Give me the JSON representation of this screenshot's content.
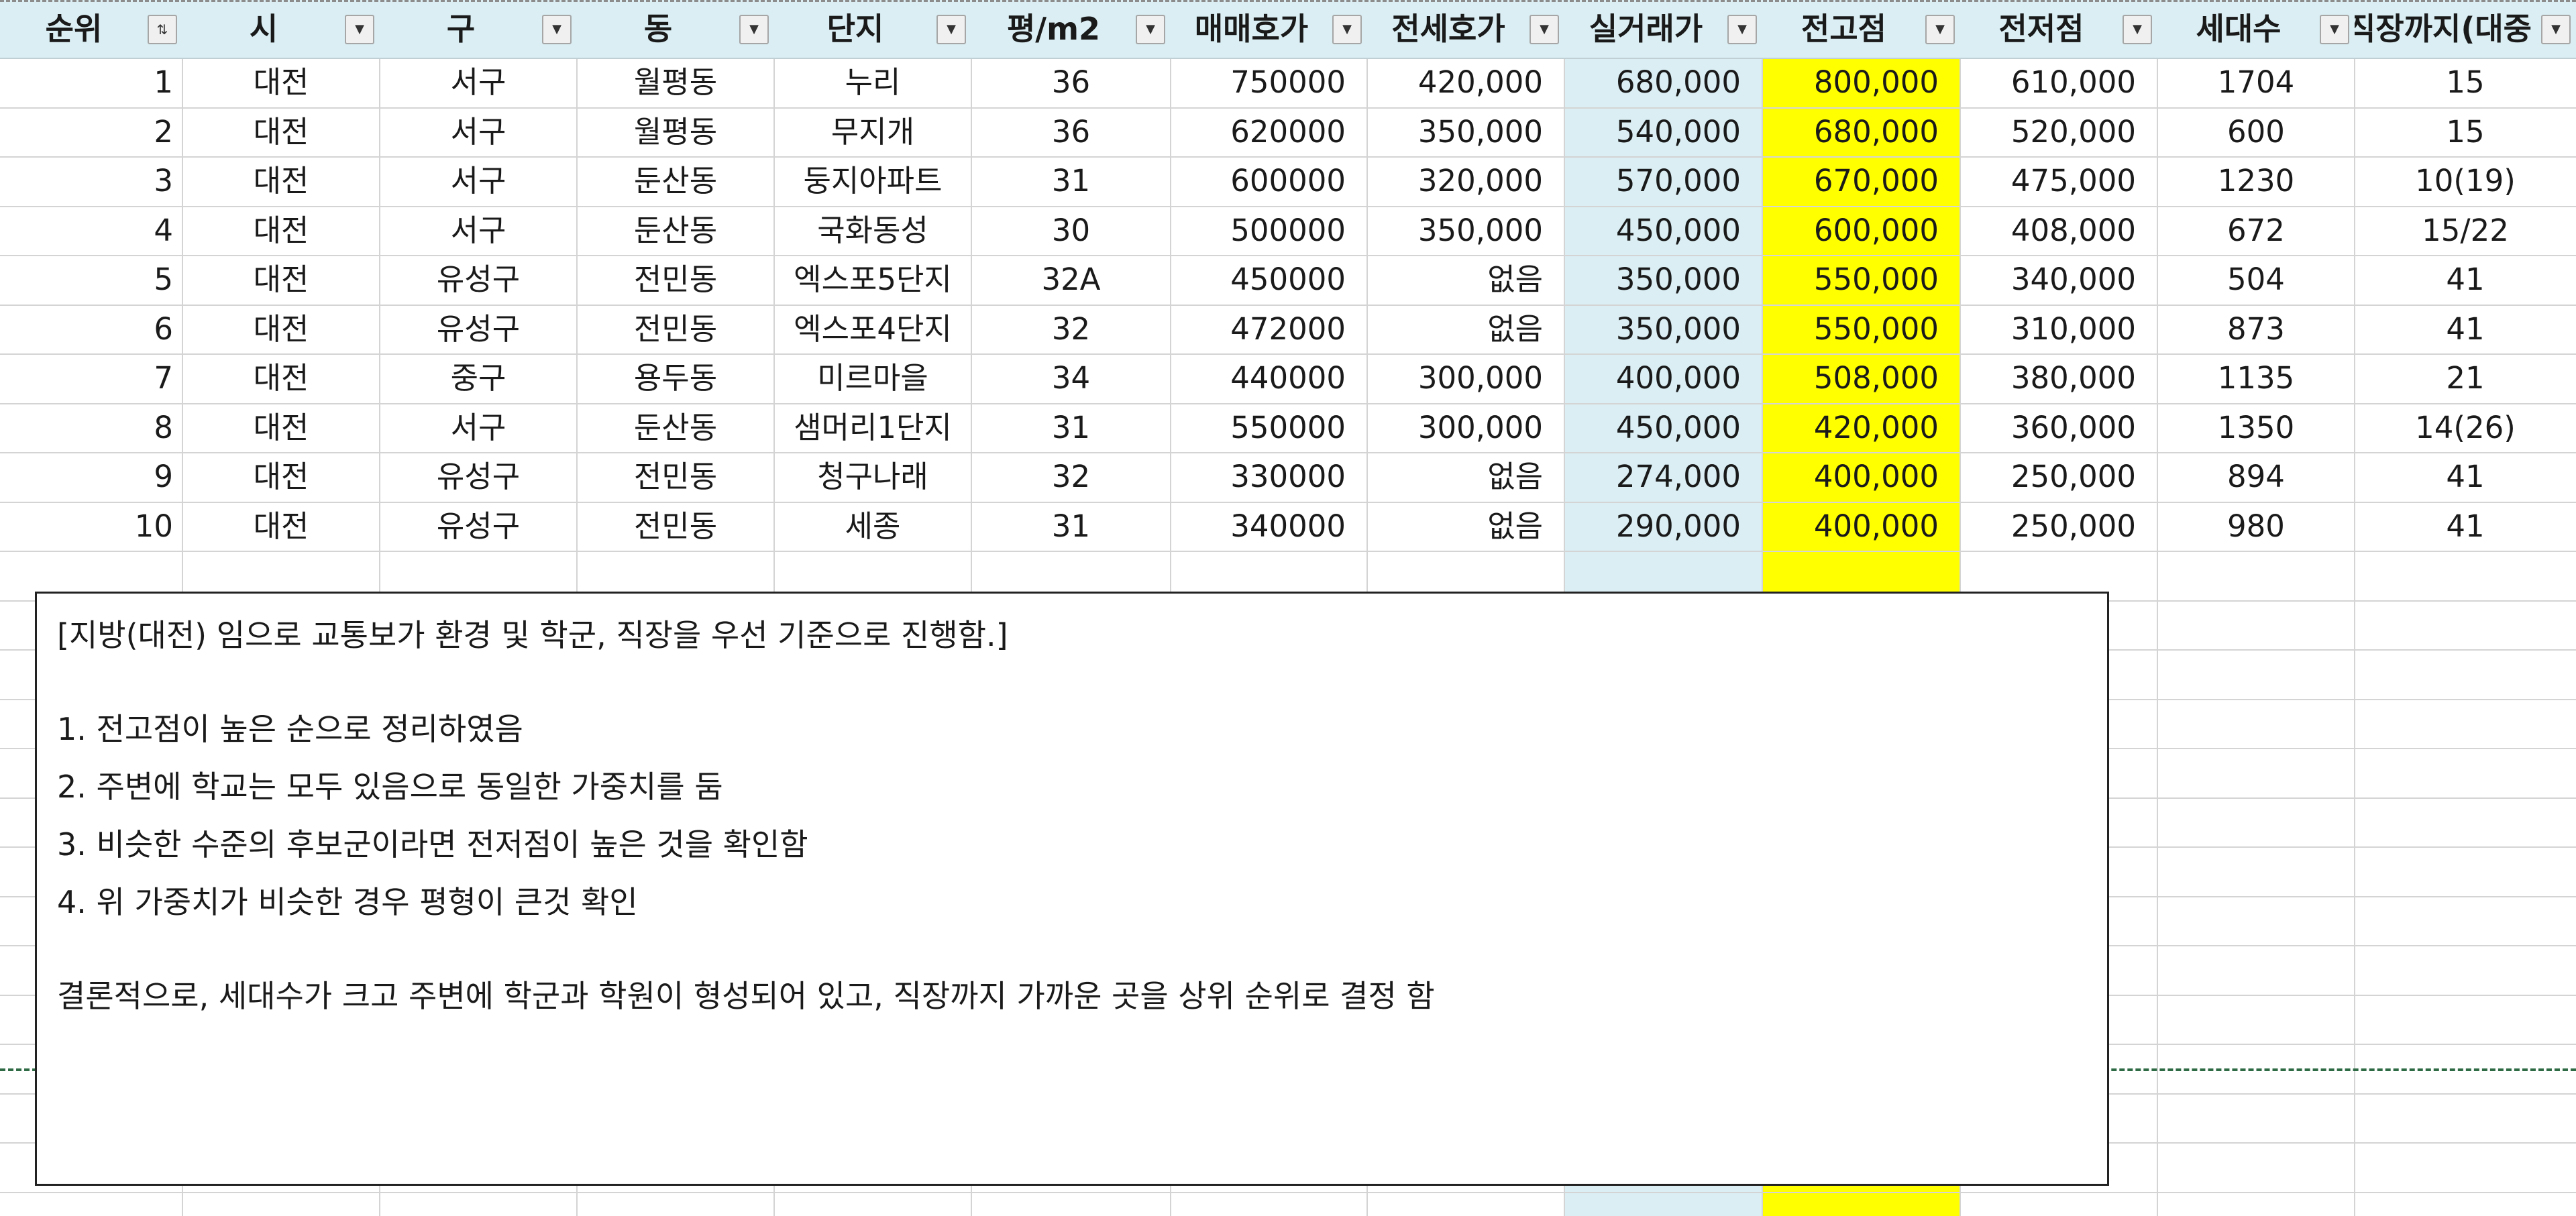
{
  "sheet": {
    "columns": [
      {
        "key": "rank",
        "label": "순위",
        "filter": "sorted"
      },
      {
        "key": "city",
        "label": "시",
        "filter": "dropdown"
      },
      {
        "key": "district",
        "label": "구",
        "filter": "dropdown"
      },
      {
        "key": "dong",
        "label": "동",
        "filter": "dropdown"
      },
      {
        "key": "complex",
        "label": "단지",
        "filter": "dropdown"
      },
      {
        "key": "size",
        "label": "평/m2",
        "filter": "dropdown"
      },
      {
        "key": "sale_ask",
        "label": "매매호가",
        "filter": "dropdown"
      },
      {
        "key": "jeonse_ask",
        "label": "전세호가",
        "filter": "dropdown"
      },
      {
        "key": "actual_trade",
        "label": "실거래가",
        "filter": "dropdown"
      },
      {
        "key": "peak_price",
        "label": "전고점",
        "filter": "dropdown"
      },
      {
        "key": "low_price",
        "label": "전저점",
        "filter": "dropdown"
      },
      {
        "key": "households",
        "label": "세대수",
        "filter": "dropdown"
      },
      {
        "key": "commute",
        "label": "직장까지(대중",
        "filter": "dropdown"
      }
    ],
    "rows": [
      [
        "1",
        "대전",
        "서구",
        "월평동",
        "누리",
        "36",
        "750000",
        "420,000",
        "680,000",
        "800,000",
        "610,000",
        "1704",
        "15"
      ],
      [
        "2",
        "대전",
        "서구",
        "월평동",
        "무지개",
        "36",
        "620000",
        "350,000",
        "540,000",
        "680,000",
        "520,000",
        "600",
        "15"
      ],
      [
        "3",
        "대전",
        "서구",
        "둔산동",
        "둥지아파트",
        "31",
        "600000",
        "320,000",
        "570,000",
        "670,000",
        "475,000",
        "1230",
        "10(19)"
      ],
      [
        "4",
        "대전",
        "서구",
        "둔산동",
        "국화동성",
        "30",
        "500000",
        "350,000",
        "450,000",
        "600,000",
        "408,000",
        "672",
        "15/22"
      ],
      [
        "5",
        "대전",
        "유성구",
        "전민동",
        "엑스포5단지",
        "32A",
        "450000",
        "없음",
        "350,000",
        "550,000",
        "340,000",
        "504",
        "41"
      ],
      [
        "6",
        "대전",
        "유성구",
        "전민동",
        "엑스포4단지",
        "32",
        "472000",
        "없음",
        "350,000",
        "550,000",
        "310,000",
        "873",
        "41"
      ],
      [
        "7",
        "대전",
        "중구",
        "용두동",
        "미르마을",
        "34",
        "440000",
        "300,000",
        "400,000",
        "508,000",
        "380,000",
        "1135",
        "21"
      ],
      [
        "8",
        "대전",
        "서구",
        "둔산동",
        "샘머리1단지",
        "31",
        "550000",
        "300,000",
        "450,000",
        "420,000",
        "360,000",
        "1350",
        "14(26)"
      ],
      [
        "9",
        "대전",
        "유성구",
        "전민동",
        "청구나래",
        "32",
        "330000",
        "없음",
        "274,000",
        "400,000",
        "250,000",
        "894",
        "41"
      ],
      [
        "10",
        "대전",
        "유성구",
        "전민동",
        "세종",
        "31",
        "340000",
        "없음",
        "290,000",
        "400,000",
        "250,000",
        "980",
        "41"
      ]
    ],
    "colors": {
      "header_bg": "#daeef3",
      "actual_trade_col": "#daeef3",
      "peak_price_col": "#ffff00",
      "page_break_line": "#2e6b45"
    }
  },
  "notes": {
    "heading": "[지방(대전) 임으로 교통보가 환경 및 학군, 직장을 우선 기준으로 진행함.]",
    "items": [
      "1. 전고점이 높은 순으로 정리하였음",
      "2. 주변에 학교는 모두 있음으로 동일한 가중치를 둠",
      "3. 비슷한 수준의 후보군이라면 전저점이 높은 것을 확인함",
      "4. 위 가중치가 비슷한 경우 평형이 큰것 확인"
    ],
    "conclusion": "결론적으로, 세대수가 크고 주변에 학군과 학원이 형성되어 있고, 직장까지 가까운 곳을 상위 순위로 결정 함"
  }
}
